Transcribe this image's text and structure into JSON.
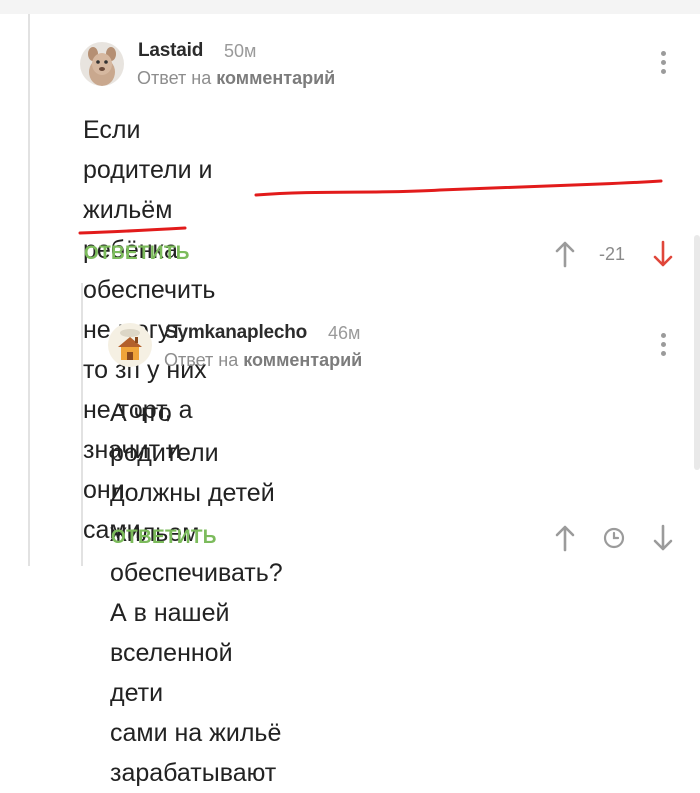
{
  "comments": [
    {
      "author": "Lastaid",
      "time": "50м",
      "reply_prefix": "Ответ на ",
      "reply_link": "комментарий",
      "text_lines": [
        "Если родители и жильём ребёнка обеспечить",
        "не могут, то зп у них не торт, а значит и они",
        "сами."
      ],
      "reply_button": "ОТВЕТИТЬ",
      "score": "-21",
      "icons": [
        "avatar-dog",
        "menu-dots-icon",
        "arrow-up-icon",
        "arrow-down-icon"
      ]
    },
    {
      "author": "Symkanaplecho",
      "time": "46м",
      "reply_prefix": "Ответ на ",
      "reply_link": "комментарий",
      "text_lines": [
        "А что родители должны детей жильем",
        "обеспечивать? А в нашей вселенной дети",
        "сами на жильё зарабатывают"
      ],
      "reply_button": "ОТВЕТИТЬ",
      "icons": [
        "avatar-house",
        "menu-dots-icon",
        "arrow-up-icon",
        "clock-icon",
        "arrow-down-icon"
      ]
    }
  ],
  "colors": {
    "accent_green": "#7cbb5c",
    "downvote_red": "#e0463a",
    "underline_red": "#e21b1b",
    "icon_gray": "#9b9b9b"
  }
}
